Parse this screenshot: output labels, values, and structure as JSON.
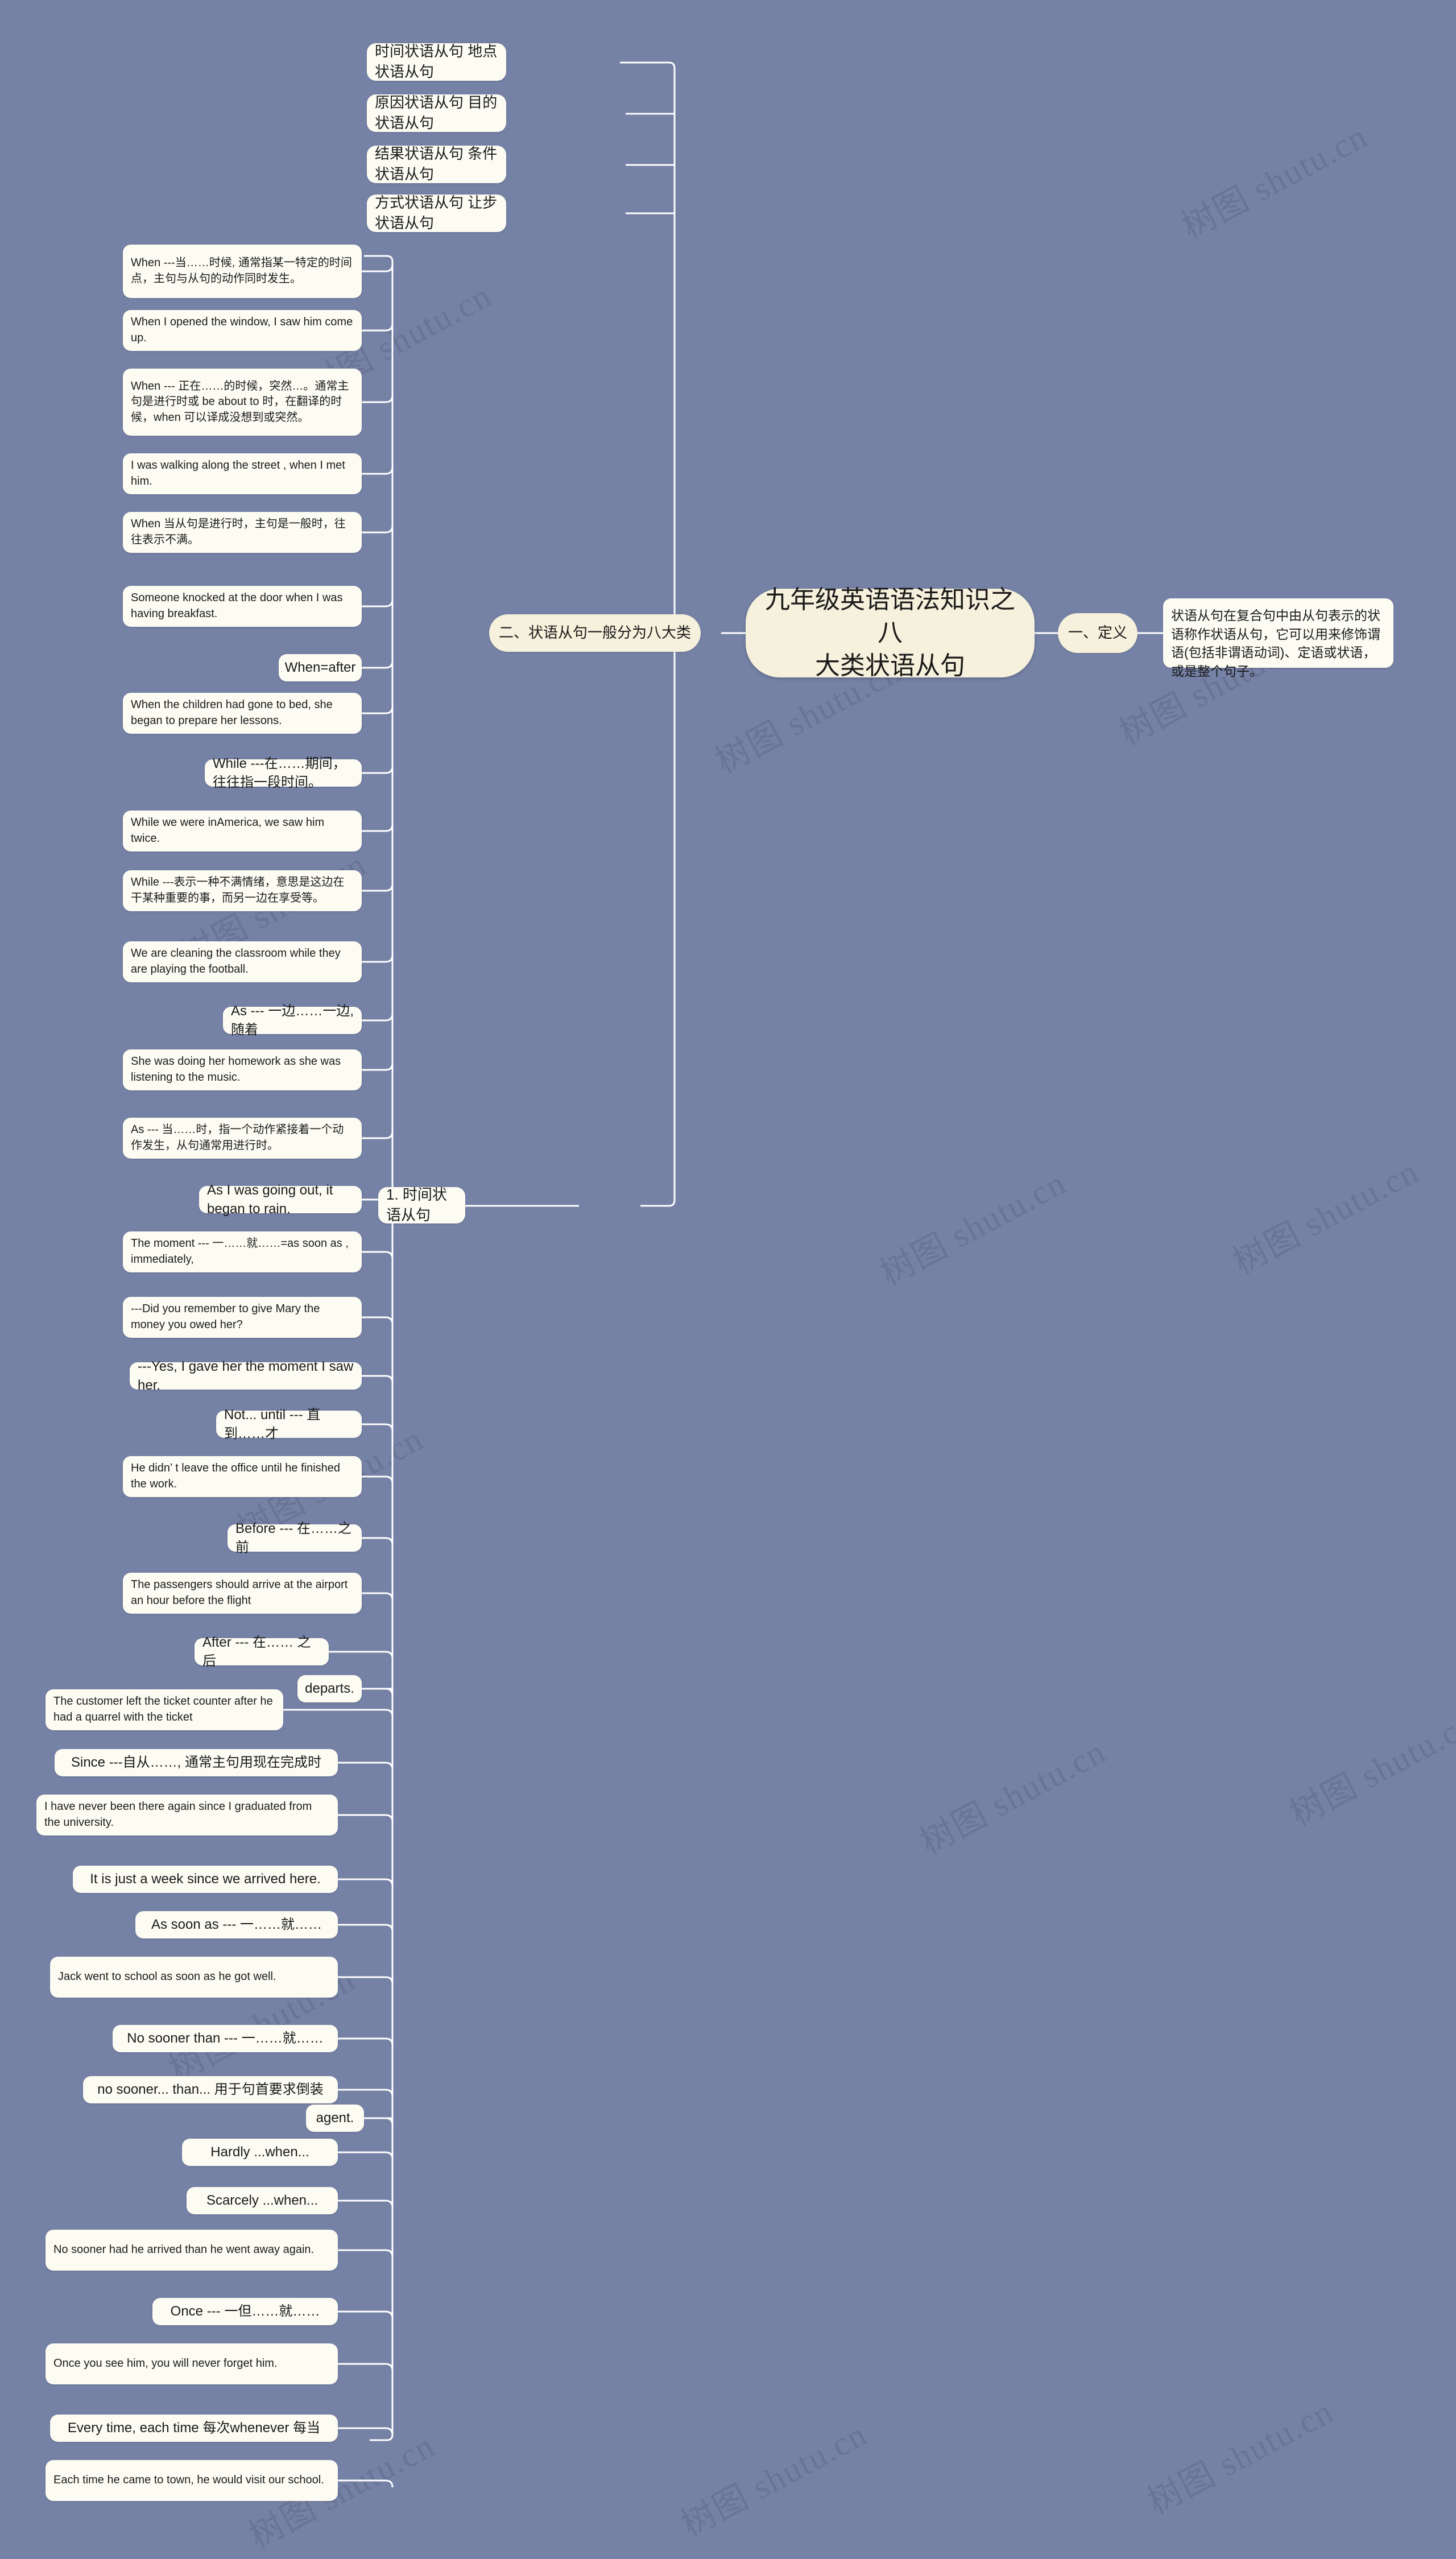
{
  "document": {
    "title": "九年级英语语法知识之八大类状语从句",
    "background_color": "#7581a5",
    "node_fill": "#fdfcf3",
    "accent_fill": "#f6f1dc",
    "watermark": "树图 shutu.cn"
  },
  "center": {
    "label": "九年级英语语法知识之八\n大类状语从句"
  },
  "branches": {
    "definition": {
      "label": "一、定义",
      "content": "状语从句在复合句中由从句表示的状语称作状语从句，它可以用来修饰谓语(包括非谓语动词)、定语或状语，或是整个句子。"
    },
    "classification": {
      "label": "二、状语从句一般分为八大类",
      "categories": [
        "时间状语从句 地点状语从句",
        "原因状语从句 目的状语从句",
        "结果状语从句 条件状语从句",
        "方式状语从句 让步状语从句"
      ],
      "subbranch": {
        "label": "1. 时间状语从句",
        "items": [
          "When ---当……时候, 通常指某一特定的时间点，主句与从句的动作同时发生。",
          "When I opened the window, I saw him come up.",
          "When --- 正在……的时候，突然…。通常主句是进行时或 be about to 时，在翻译的时候，when 可以译成没想到或突然。",
          "I was walking along the street , when I met him.",
          "When 当从句是进行时，主句是一般时，往往表示不满。",
          "Someone knocked at the door when I was having breakfast.",
          "When=after",
          "When the children had gone to bed, she began to prepare her lessons.",
          "While ---在……期间，往往指一段时间。",
          "While we were inAmerica, we saw him twice.",
          "While ---表示一种不满情绪，意思是这边在干某种重要的事，而另一边在享受等。",
          "We are cleaning the classroom while they are playing the football.",
          "As --- 一边……一边, 随着",
          "She was doing her homework as she was listening to the music.",
          "As --- 当……时，指一个动作紧接着一个动作发生，从句通常用进行时。",
          "As I was going out, it began to rain.",
          "The moment --- 一……就……=as soon as , immediately,",
          "---Did you remember to give Mary the money you owed her?",
          "---Yes, I gave her the moment I saw her.",
          "Not... until --- 直到……才",
          "He didn’ t leave the office until he finished the work.",
          "Before --- 在……之前",
          "The passengers should arrive at the airport an hour before the flight",
          "departs.",
          "After --- 在…… 之后",
          "The customer left the ticket counter after he had a quarrel with the ticket",
          "agent.",
          "Since ---自从……, 通常主句用现在完成时",
          "I have never been there again since I graduated from the university.",
          "It is just a week since we arrived here.",
          "As soon as --- 一……就……",
          "Jack went to school as soon as he got well.",
          "No sooner than --- 一……就……",
          "no sooner... than... 用于句首要求倒装",
          "Hardly ...when...",
          "Scarcely ...when...",
          "No sooner had he arrived than he went away again.",
          "Once --- 一但……就……",
          "Once you see him, you will never forget him.",
          "Every time, each time 每次whenever 每当",
          "Each time he came to town, he would visit our school."
        ]
      }
    }
  }
}
